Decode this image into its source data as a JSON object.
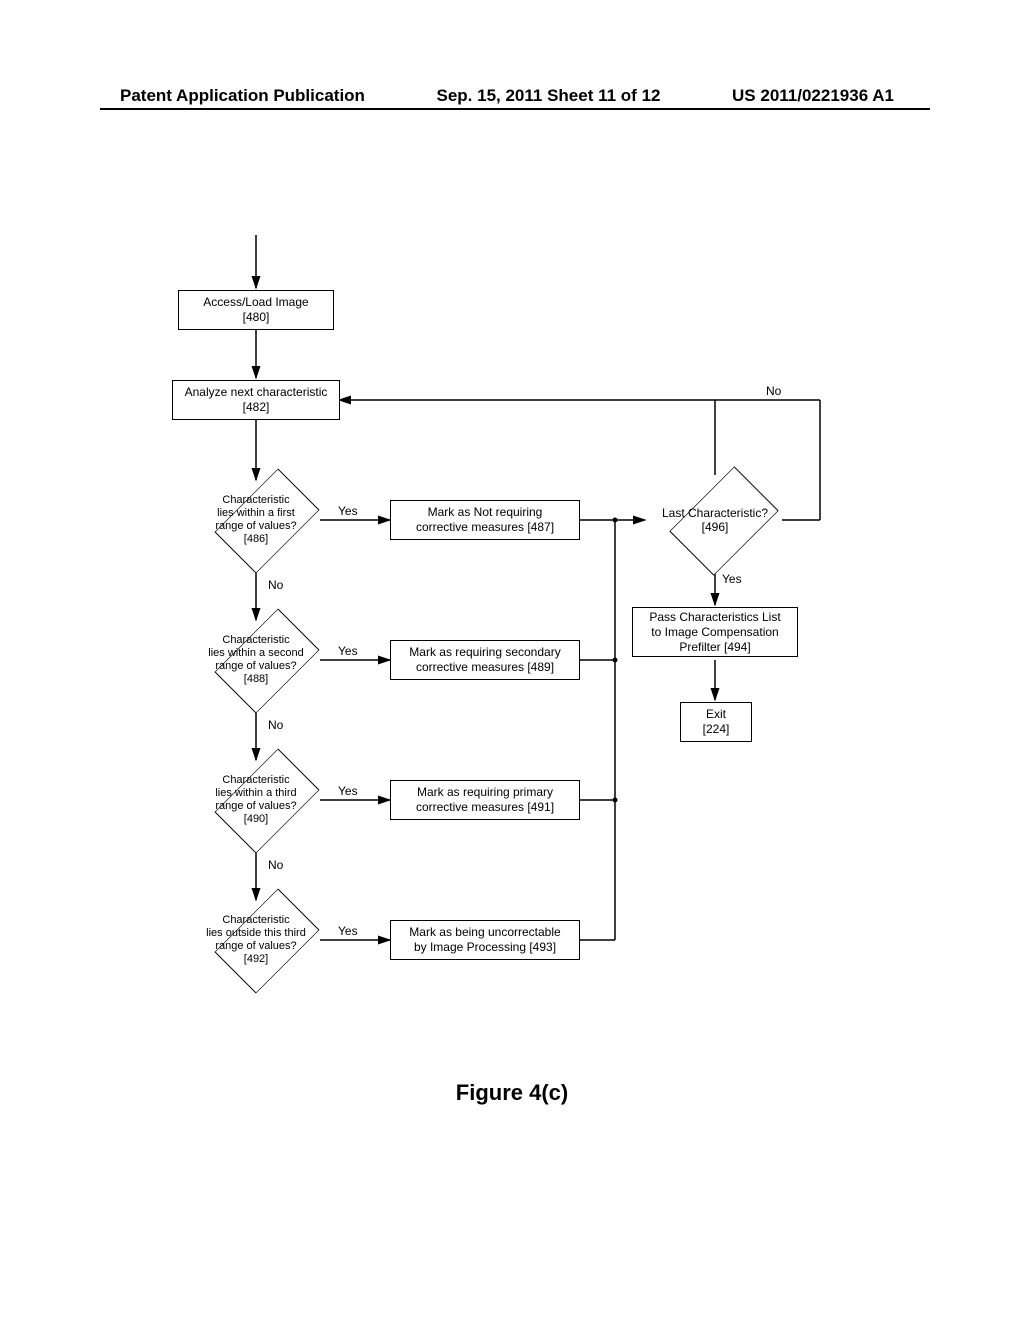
{
  "header": {
    "left": "Patent Application Publication",
    "middle": "Sep. 15, 2011  Sheet 11 of 12",
    "right": "US 2011/0221936 A1"
  },
  "figure_label": "Figure 4(c)",
  "nodes": {
    "n480": {
      "line1": "Access/Load Image",
      "line2": "[480]"
    },
    "n482": {
      "line1": "Analyze next characteristic",
      "line2": "[482]"
    },
    "d486": {
      "line1": "Characteristic",
      "line2": "lies within a first",
      "line3": "range of values?",
      "line4": "[486]"
    },
    "n487": {
      "line1": "Mark as Not requiring",
      "line2": "corrective measures [487]"
    },
    "d488": {
      "line1": "Characteristic",
      "line2": "lies within a second",
      "line3": "range of values?",
      "line4": "[488]"
    },
    "n489": {
      "line1": "Mark as requiring secondary",
      "line2": "corrective measures [489]"
    },
    "d490": {
      "line1": "Characteristic",
      "line2": "lies within a third",
      "line3": "range of values?",
      "line4": "[490]"
    },
    "n491": {
      "line1": "Mark as requiring primary",
      "line2": "corrective measures [491]"
    },
    "d492": {
      "line1": "Characteristic",
      "line2": "lies outside this third",
      "line3": "range of values?",
      "line4": "[492]"
    },
    "n493": {
      "line1": "Mark as being uncorrectable",
      "line2": "by Image Processing  [493]"
    },
    "d496": {
      "line1": "Last Characteristic?",
      "line2": "[496]"
    },
    "n494": {
      "line1": "Pass Characteristics List",
      "line2": "to Image Compensation",
      "line3": "Prefilter  [494]"
    },
    "n224": {
      "line1": "Exit",
      "line2": "[224]"
    }
  },
  "labels": {
    "yes": "Yes",
    "no": "No"
  }
}
